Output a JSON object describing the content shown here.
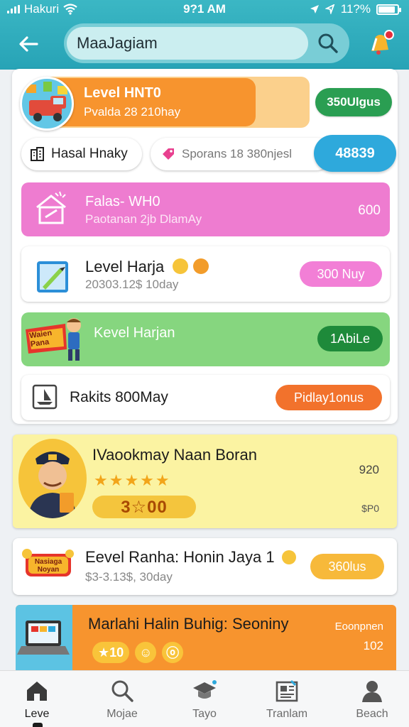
{
  "status_bar": {
    "carrier": "Hakuri",
    "time": "9?1 AM",
    "battery": "11?%",
    "battery_level": 0.9
  },
  "header": {
    "search": {
      "value": "MaaJagiam",
      "placeholder": ""
    },
    "icons": {
      "back": "back-arrow-icon",
      "search": "search-icon",
      "notifications": "bell-icon"
    }
  },
  "level_row": {
    "title": "Level HNT0",
    "subtitle": "Pvalda 28 210hay",
    "badge": "350Ulgus"
  },
  "chips": {
    "chip1": "Hasal Hnaky",
    "chip2": "Sporans 18 380njesl",
    "chip2_value": "48839"
  },
  "pink_card": {
    "title": "Falas- WH0",
    "subtitle": "Paotanan 2jb DlamAy",
    "value": "600"
  },
  "level_harja": {
    "title": "Level Harja",
    "subtitle": "20303.12$ 10day",
    "pill": "300 Nuy"
  },
  "green_card": {
    "badge_text": "Waien Pana",
    "title": "Kevel Harjan",
    "pill": "1AbiLe"
  },
  "rakils_row": {
    "title": "Rakits 800May",
    "pill": "Pidlay1onus"
  },
  "featured": {
    "title": "IVaookmay Naan Boran",
    "rating": 5,
    "stars": "★★★★★",
    "coins": "3☆00",
    "value_top": "920",
    "value_bottom": "$P0"
  },
  "eevel_row": {
    "badge_text": "Nasiaga Noyan",
    "title": "Eevel Ranha: Honin Jaya 1",
    "subtitle": "$3-3.13$, 30day",
    "pill": "360lus"
  },
  "orange_card": {
    "title": "Marlahi Halin Buhig: Seoniny",
    "score": "★10",
    "label_top": "Eoonpnen",
    "label_bottom": "102"
  },
  "bottom_nav": {
    "items": [
      {
        "label": "Leve",
        "icon": "home-icon",
        "active": true
      },
      {
        "label": "Mojae",
        "icon": "search-icon",
        "active": false
      },
      {
        "label": "Tayo",
        "icon": "graduation-cap-icon",
        "active": false
      },
      {
        "label": "Tranlam",
        "icon": "newspaper-icon",
        "active": false
      },
      {
        "label": "Beach",
        "icon": "profile-icon",
        "active": false
      }
    ]
  },
  "colors": {
    "header": "#27a3b6",
    "orange": "#f7942e",
    "green": "#2a9e52",
    "pink": "#ee7cd0",
    "blue": "#2ea9dc",
    "yellow": "#fbf3a2"
  }
}
